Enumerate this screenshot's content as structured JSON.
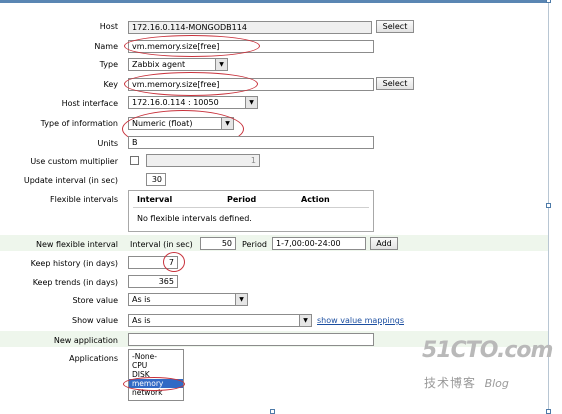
{
  "form": {
    "host": {
      "label": "Host",
      "value": "172.16.0.114-MONGODB114",
      "button": "Select"
    },
    "name": {
      "label": "Name",
      "value": "vm.memory.size[free]"
    },
    "type": {
      "label": "Type",
      "value": "Zabbix agent"
    },
    "key": {
      "label": "Key",
      "value": "vm.memory.size[free]",
      "button": "Select"
    },
    "host_interface": {
      "label": "Host interface",
      "value": "172.16.0.114 : 10050"
    },
    "type_of_information": {
      "label": "Type of information",
      "value": "Numeric (float)"
    },
    "units": {
      "label": "Units",
      "value": "B"
    },
    "custom_multiplier": {
      "label": "Use custom multiplier",
      "value": "1"
    },
    "update_interval": {
      "label": "Update interval (in sec)",
      "value": "30"
    },
    "flexible_intervals": {
      "label": "Flexible intervals",
      "headers": [
        "Interval",
        "Period",
        "Action"
      ],
      "empty_text": "No flexible intervals defined."
    },
    "new_flexible_interval": {
      "label": "New flexible interval",
      "interval_label": "Interval (in sec)",
      "interval_value": "50",
      "period_label": "Period",
      "period_value": "1-7,00:00-24:00",
      "add_button": "Add"
    },
    "keep_history": {
      "label": "Keep history (in days)",
      "value": "7"
    },
    "keep_trends": {
      "label": "Keep trends (in days)",
      "value": "365"
    },
    "store_value": {
      "label": "Store value",
      "value": "As is"
    },
    "show_value": {
      "label": "Show value",
      "value": "As is",
      "link": "show value mappings"
    },
    "new_application": {
      "label": "New application",
      "value": ""
    },
    "applications": {
      "label": "Applications",
      "options": [
        "-None-",
        "CPU",
        "DISK",
        "memory",
        "network"
      ],
      "selected": "memory"
    }
  },
  "watermark": {
    "brand": "51CTO.com",
    "tagline": "技术博客",
    "blog": "Blog"
  },
  "colors": {
    "highlight_oval": "#c8323c",
    "stripe": "#eef6ec",
    "selection": "#316ac5",
    "link": "#1b4ea0"
  }
}
